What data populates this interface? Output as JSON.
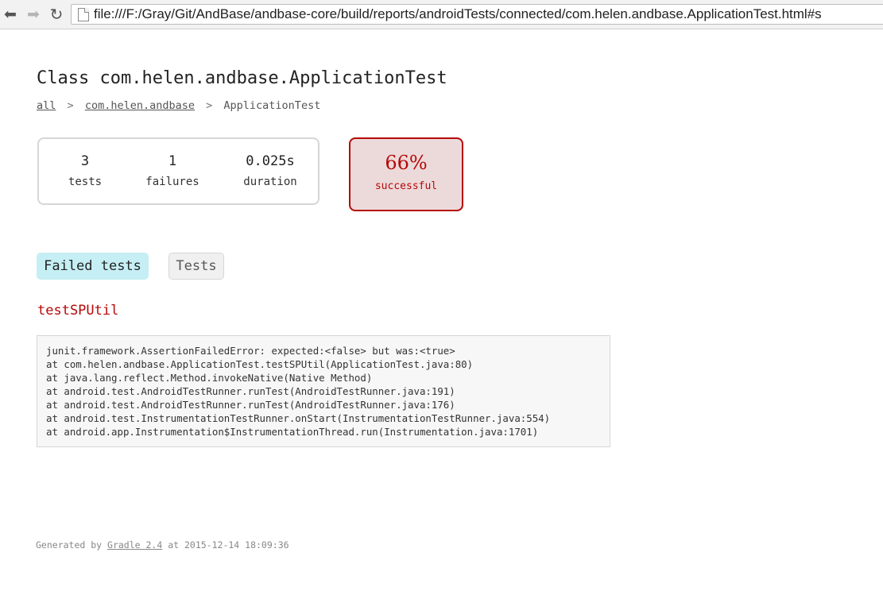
{
  "browser": {
    "url": "file:///F:/Gray/Git/AndBase/andbase-core/build/reports/androidTests/connected/com.helen.andbase.ApplicationTest.html#s",
    "back_glyph": "⬅",
    "forward_glyph": "➡",
    "reload_glyph": "↻"
  },
  "page": {
    "title": "Class com.helen.andbase.ApplicationTest",
    "breadcrumbs": [
      {
        "label": "all",
        "link": true
      },
      {
        "label": "com.helen.andbase",
        "link": true
      },
      {
        "label": "ApplicationTest",
        "link": false
      }
    ],
    "breadcrumb_separator": ">"
  },
  "summary": {
    "tests": {
      "value": "3",
      "label": "tests"
    },
    "failures": {
      "value": "1",
      "label": "failures"
    },
    "duration": {
      "value": "0.025s",
      "label": "duration"
    },
    "success": {
      "value": "66%",
      "label": "successful",
      "color": "#b60808"
    }
  },
  "tabs": [
    {
      "label": "Failed tests",
      "selected": true
    },
    {
      "label": "Tests",
      "selected": false
    }
  ],
  "failed_test": {
    "name": "testSPUtil",
    "stack_trace": [
      "junit.framework.AssertionFailedError: expected:<false> but was:<true>",
      "at com.helen.andbase.ApplicationTest.testSPUtil(ApplicationTest.java:80)",
      "at java.lang.reflect.Method.invokeNative(Native Method)",
      "at android.test.AndroidTestRunner.runTest(AndroidTestRunner.java:191)",
      "at android.test.AndroidTestRunner.runTest(AndroidTestRunner.java:176)",
      "at android.test.InstrumentationTestRunner.onStart(InstrumentationTestRunner.java:554)",
      "at android.app.Instrumentation$InstrumentationThread.run(Instrumentation.java:1701)"
    ]
  },
  "footer": {
    "prefix": "Generated by",
    "link": "Gradle 2.4",
    "suffix": "at 2015-12-14 18:09:36"
  },
  "colors": {
    "failure": "#b60808",
    "selected_tab": "#c5eff4"
  }
}
